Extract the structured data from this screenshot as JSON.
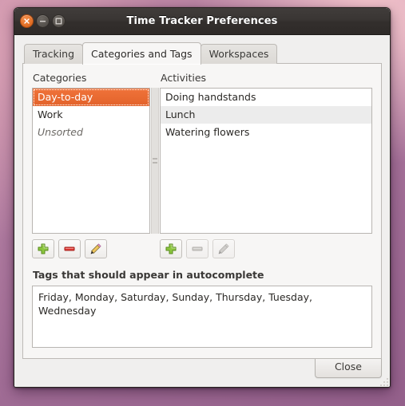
{
  "window": {
    "title": "Time Tracker Preferences",
    "controls": {
      "close_label": "×",
      "minimize_label": "–",
      "maximize_label": "□"
    }
  },
  "tabs": [
    {
      "label": "Tracking",
      "active": false
    },
    {
      "label": "Categories and Tags",
      "active": true
    },
    {
      "label": "Workspaces",
      "active": false
    }
  ],
  "categories": {
    "label": "Categories",
    "items": [
      {
        "name": "Day-to-day",
        "state": "selected"
      },
      {
        "name": "Work",
        "state": "normal"
      },
      {
        "name": "Unsorted",
        "state": "muted"
      }
    ],
    "buttons": [
      {
        "name": "add-category-button",
        "icon": "plus-icon",
        "enabled": true
      },
      {
        "name": "remove-category-button",
        "icon": "minus-icon",
        "enabled": true
      },
      {
        "name": "edit-category-button",
        "icon": "pencil-icon",
        "enabled": true
      }
    ]
  },
  "activities": {
    "label": "Activities",
    "items": [
      {
        "name": "Doing handstands",
        "state": "normal"
      },
      {
        "name": "Lunch",
        "state": "alt"
      },
      {
        "name": "Watering flowers",
        "state": "normal"
      }
    ],
    "buttons": [
      {
        "name": "add-activity-button",
        "icon": "plus-icon",
        "enabled": true
      },
      {
        "name": "remove-activity-button",
        "icon": "minus-icon",
        "enabled": false
      },
      {
        "name": "edit-activity-button",
        "icon": "pencil-icon",
        "enabled": false
      }
    ]
  },
  "tags": {
    "label": "Tags that should appear in autocomplete",
    "value": "Friday, Monday, Saturday, Sunday, Thursday, Tuesday, Wednesday"
  },
  "actions": {
    "close_label": "Close"
  },
  "colors": {
    "selection": "#e2622a",
    "titlebar": "#393533",
    "close_button": "#e8762c",
    "panel": "#f7f6f5",
    "window_bg": "#f0efee"
  }
}
